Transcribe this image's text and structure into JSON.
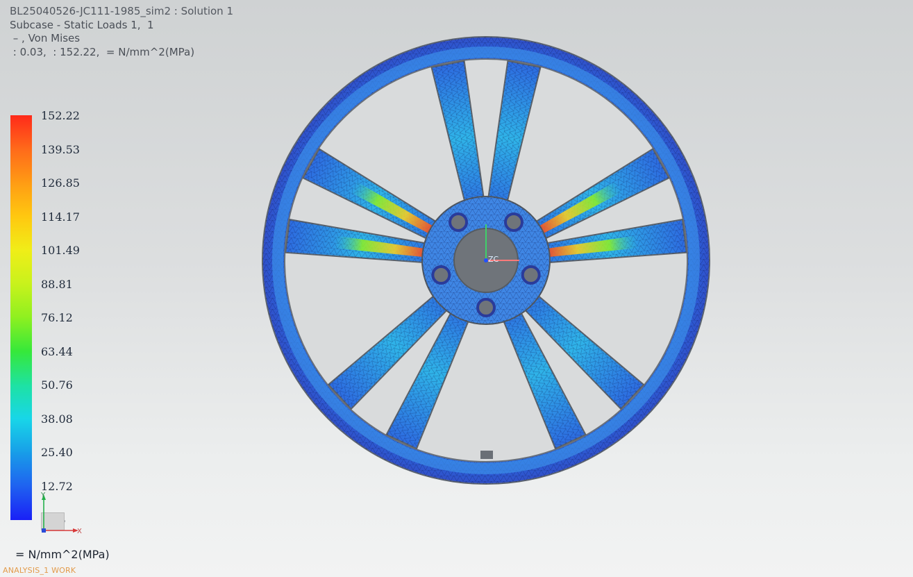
{
  "header": {
    "title": "BL25040526-JC111-1985_sim2 : Solution 1",
    "subcase": "Subcase - Static Loads 1,  1",
    "result": " – , Von Mises",
    "range": " : 0.03,  : 152.22,  = N/mm^2(MPa)"
  },
  "legend": {
    "labels": [
      "152.22",
      "139.53",
      "126.85",
      "114.17",
      "101.49",
      "88.81",
      "76.12",
      "63.44",
      "50.76",
      "38.08",
      "25.40",
      "12.72",
      "0.03"
    ],
    "colors": [
      "#ff2a1a",
      "#ff6a1a",
      "#ff9c14",
      "#ffc810",
      "#f0ee18",
      "#c8f21c",
      "#8ef020",
      "#36e83a",
      "#1ee2a2",
      "#18d6e8",
      "#189ee8",
      "#1f62f0",
      "#1a20f6"
    ]
  },
  "axis_triad": {
    "x_label": "X",
    "y_label": "Y"
  },
  "model_csys": {
    "label": "ZC"
  },
  "footer": {
    "units": "= N/mm^2(MPa)"
  },
  "status": {
    "text": "ANALYSIS_1 WORK"
  }
}
